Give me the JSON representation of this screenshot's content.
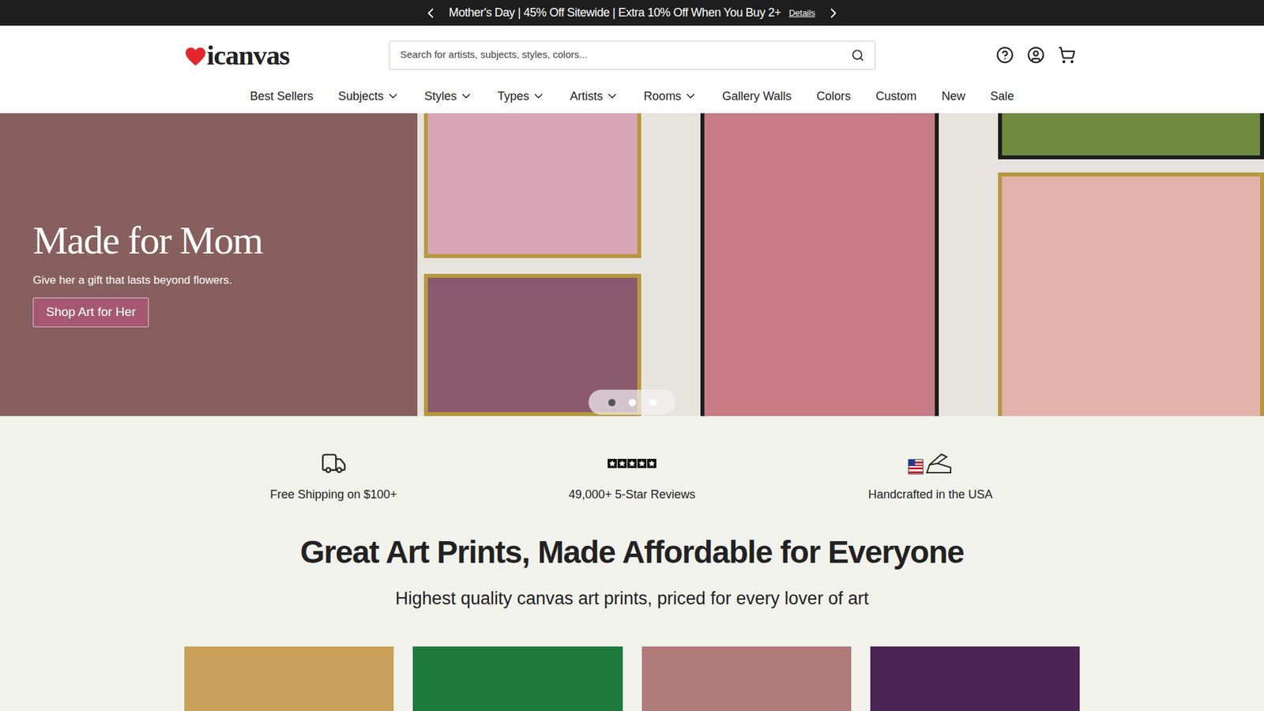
{
  "promo_bar": {
    "text": "Mother's Day | 45% Off Sitewide | Extra 10% Off When You Buy 2+",
    "link": "Details"
  },
  "logo": "icanvas",
  "search": {
    "placeholder": "Search for artists, subjects, styles, colors..."
  },
  "nav": [
    {
      "label": "Best Sellers",
      "dropdown": false
    },
    {
      "label": "Subjects",
      "dropdown": true
    },
    {
      "label": "Styles",
      "dropdown": true
    },
    {
      "label": "Types",
      "dropdown": true
    },
    {
      "label": "Artists",
      "dropdown": true
    },
    {
      "label": "Rooms",
      "dropdown": true
    },
    {
      "label": "Gallery Walls",
      "dropdown": false
    },
    {
      "label": "Colors",
      "dropdown": false
    },
    {
      "label": "Custom",
      "dropdown": false
    },
    {
      "label": "New",
      "dropdown": false
    },
    {
      "label": "Sale",
      "dropdown": false
    }
  ],
  "hero": {
    "title": "Made for Mom",
    "subtitle": "Give her a gift that lasts beyond flowers.",
    "button": "Shop Art for Her",
    "dots": [
      {
        "selected": true
      },
      {
        "selected": false
      },
      {
        "selected": false
      }
    ]
  },
  "features": [
    {
      "label": "Free Shipping on $100+",
      "kind": "truck"
    },
    {
      "label": "49,000+ 5-Star Reviews",
      "kind": "stars",
      "stars": 5
    },
    {
      "label": "Handcrafted in the USA",
      "kind": "usa"
    }
  ],
  "intro": {
    "title": "Great Art Prints, Made Affordable for Everyone",
    "subtitle": "Highest quality canvas art prints, priced for every lover of art"
  },
  "products": [
    {
      "color": "#c9a05a"
    },
    {
      "color": "#1e7a3c"
    },
    {
      "color": "#b07a78"
    },
    {
      "color": "#4a2452"
    }
  ]
}
